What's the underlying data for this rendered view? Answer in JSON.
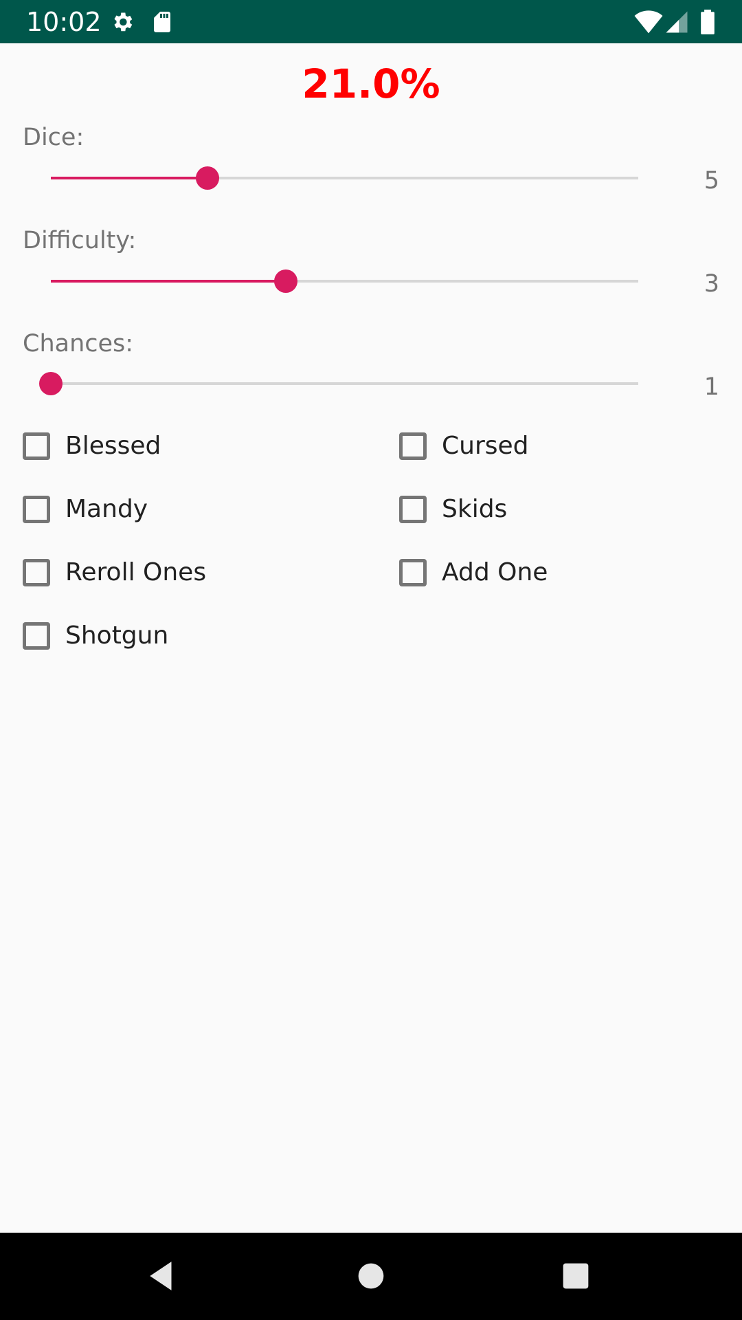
{
  "status_bar": {
    "time": "10:02",
    "left_icons": [
      "settings-icon",
      "sd-card-icon"
    ],
    "right_icons": [
      "wifi-icon",
      "cell-signal-icon",
      "battery-icon"
    ],
    "background": "#00574b"
  },
  "result": {
    "text": "21.0%",
    "color": "#ff0000"
  },
  "sliders": [
    {
      "label": "Dice:",
      "value": "5",
      "fraction": 0.267
    },
    {
      "label": "Difficulty:",
      "value": "3",
      "fraction": 0.4
    },
    {
      "label": "Chances:",
      "value": "1",
      "fraction": 0.0
    }
  ],
  "checkboxes": [
    {
      "label": "Blessed",
      "checked": false
    },
    {
      "label": "Cursed",
      "checked": false
    },
    {
      "label": "Mandy",
      "checked": false
    },
    {
      "label": "Skids",
      "checked": false
    },
    {
      "label": "Reroll Ones",
      "checked": false
    },
    {
      "label": "Add One",
      "checked": false
    },
    {
      "label": "Shotgun",
      "checked": false
    }
  ],
  "accent_color": "#d81b60",
  "nav_bar": {
    "buttons": [
      "back-icon",
      "home-icon",
      "recents-icon"
    ]
  }
}
